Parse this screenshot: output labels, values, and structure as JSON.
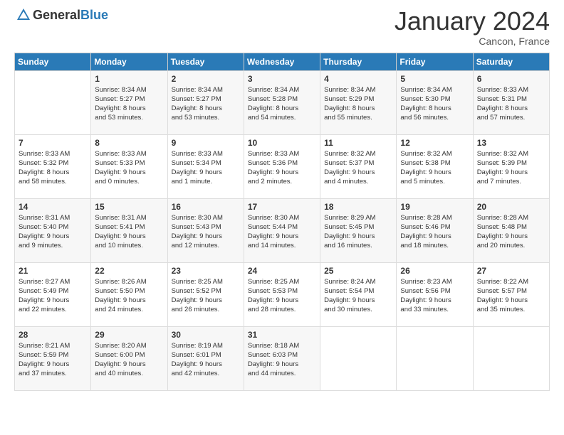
{
  "logo": {
    "general": "General",
    "blue": "Blue"
  },
  "header": {
    "month": "January 2024",
    "location": "Cancon, France"
  },
  "weekdays": [
    "Sunday",
    "Monday",
    "Tuesday",
    "Wednesday",
    "Thursday",
    "Friday",
    "Saturday"
  ],
  "weeks": [
    [
      {
        "day": "",
        "info": ""
      },
      {
        "day": "1",
        "info": "Sunrise: 8:34 AM\nSunset: 5:27 PM\nDaylight: 8 hours\nand 53 minutes."
      },
      {
        "day": "2",
        "info": "Sunrise: 8:34 AM\nSunset: 5:27 PM\nDaylight: 8 hours\nand 53 minutes."
      },
      {
        "day": "3",
        "info": "Sunrise: 8:34 AM\nSunset: 5:28 PM\nDaylight: 8 hours\nand 54 minutes."
      },
      {
        "day": "4",
        "info": "Sunrise: 8:34 AM\nSunset: 5:29 PM\nDaylight: 8 hours\nand 55 minutes."
      },
      {
        "day": "5",
        "info": "Sunrise: 8:34 AM\nSunset: 5:30 PM\nDaylight: 8 hours\nand 56 minutes."
      },
      {
        "day": "6",
        "info": "Sunrise: 8:33 AM\nSunset: 5:31 PM\nDaylight: 8 hours\nand 57 minutes."
      }
    ],
    [
      {
        "day": "7",
        "info": "Sunrise: 8:33 AM\nSunset: 5:32 PM\nDaylight: 8 hours\nand 58 minutes."
      },
      {
        "day": "8",
        "info": "Sunrise: 8:33 AM\nSunset: 5:33 PM\nDaylight: 9 hours\nand 0 minutes."
      },
      {
        "day": "9",
        "info": "Sunrise: 8:33 AM\nSunset: 5:34 PM\nDaylight: 9 hours\nand 1 minute."
      },
      {
        "day": "10",
        "info": "Sunrise: 8:33 AM\nSunset: 5:36 PM\nDaylight: 9 hours\nand 2 minutes."
      },
      {
        "day": "11",
        "info": "Sunrise: 8:32 AM\nSunset: 5:37 PM\nDaylight: 9 hours\nand 4 minutes."
      },
      {
        "day": "12",
        "info": "Sunrise: 8:32 AM\nSunset: 5:38 PM\nDaylight: 9 hours\nand 5 minutes."
      },
      {
        "day": "13",
        "info": "Sunrise: 8:32 AM\nSunset: 5:39 PM\nDaylight: 9 hours\nand 7 minutes."
      }
    ],
    [
      {
        "day": "14",
        "info": "Sunrise: 8:31 AM\nSunset: 5:40 PM\nDaylight: 9 hours\nand 9 minutes."
      },
      {
        "day": "15",
        "info": "Sunrise: 8:31 AM\nSunset: 5:41 PM\nDaylight: 9 hours\nand 10 minutes."
      },
      {
        "day": "16",
        "info": "Sunrise: 8:30 AM\nSunset: 5:43 PM\nDaylight: 9 hours\nand 12 minutes."
      },
      {
        "day": "17",
        "info": "Sunrise: 8:30 AM\nSunset: 5:44 PM\nDaylight: 9 hours\nand 14 minutes."
      },
      {
        "day": "18",
        "info": "Sunrise: 8:29 AM\nSunset: 5:45 PM\nDaylight: 9 hours\nand 16 minutes."
      },
      {
        "day": "19",
        "info": "Sunrise: 8:28 AM\nSunset: 5:46 PM\nDaylight: 9 hours\nand 18 minutes."
      },
      {
        "day": "20",
        "info": "Sunrise: 8:28 AM\nSunset: 5:48 PM\nDaylight: 9 hours\nand 20 minutes."
      }
    ],
    [
      {
        "day": "21",
        "info": "Sunrise: 8:27 AM\nSunset: 5:49 PM\nDaylight: 9 hours\nand 22 minutes."
      },
      {
        "day": "22",
        "info": "Sunrise: 8:26 AM\nSunset: 5:50 PM\nDaylight: 9 hours\nand 24 minutes."
      },
      {
        "day": "23",
        "info": "Sunrise: 8:25 AM\nSunset: 5:52 PM\nDaylight: 9 hours\nand 26 minutes."
      },
      {
        "day": "24",
        "info": "Sunrise: 8:25 AM\nSunset: 5:53 PM\nDaylight: 9 hours\nand 28 minutes."
      },
      {
        "day": "25",
        "info": "Sunrise: 8:24 AM\nSunset: 5:54 PM\nDaylight: 9 hours\nand 30 minutes."
      },
      {
        "day": "26",
        "info": "Sunrise: 8:23 AM\nSunset: 5:56 PM\nDaylight: 9 hours\nand 33 minutes."
      },
      {
        "day": "27",
        "info": "Sunrise: 8:22 AM\nSunset: 5:57 PM\nDaylight: 9 hours\nand 35 minutes."
      }
    ],
    [
      {
        "day": "28",
        "info": "Sunrise: 8:21 AM\nSunset: 5:59 PM\nDaylight: 9 hours\nand 37 minutes."
      },
      {
        "day": "29",
        "info": "Sunrise: 8:20 AM\nSunset: 6:00 PM\nDaylight: 9 hours\nand 40 minutes."
      },
      {
        "day": "30",
        "info": "Sunrise: 8:19 AM\nSunset: 6:01 PM\nDaylight: 9 hours\nand 42 minutes."
      },
      {
        "day": "31",
        "info": "Sunrise: 8:18 AM\nSunset: 6:03 PM\nDaylight: 9 hours\nand 44 minutes."
      },
      {
        "day": "",
        "info": ""
      },
      {
        "day": "",
        "info": ""
      },
      {
        "day": "",
        "info": ""
      }
    ]
  ]
}
